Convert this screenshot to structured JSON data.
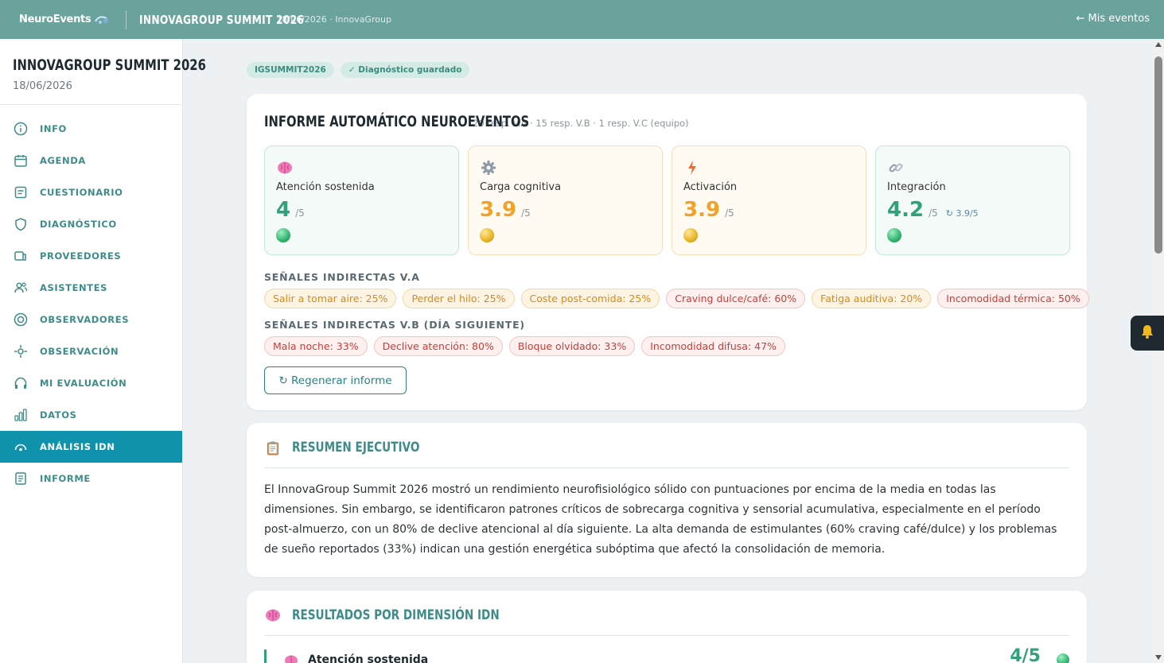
{
  "topbar": {
    "brand": "NeuroEvents",
    "event_title": "INNOVAGROUP SUMMIT 2026",
    "event_meta": "18/06/2026 · InnovaGroup",
    "back_link": "← Mis eventos"
  },
  "sidebar": {
    "title": "INNOVAGROUP SUMMIT 2026",
    "date": "18/06/2026",
    "items": [
      {
        "label": "INFO",
        "icon": "info-icon"
      },
      {
        "label": "AGENDA",
        "icon": "calendar-icon"
      },
      {
        "label": "CUESTIONARIO",
        "icon": "questionnaire-icon"
      },
      {
        "label": "DIAGNÓSTICO",
        "icon": "shield-icon"
      },
      {
        "label": "PROVEEDORES",
        "icon": "providers-icon"
      },
      {
        "label": "ASISTENTES",
        "icon": "users-icon"
      },
      {
        "label": "OBSERVADORES",
        "icon": "target-icon"
      },
      {
        "label": "OBSERVACIÓN",
        "icon": "crosshair-icon"
      },
      {
        "label": "MI EVALUACIÓN",
        "icon": "headphones-icon"
      },
      {
        "label": "DATOS",
        "icon": "bar-chart-icon"
      },
      {
        "label": "ANÁLISIS IDN",
        "icon": "gauge-icon",
        "active": true
      },
      {
        "label": "INFORME",
        "icon": "document-icon"
      }
    ]
  },
  "badges": {
    "code": "IGSUMMIT2026",
    "saved": "✓ Diagnóstico guardado"
  },
  "report": {
    "title": "INFORME AUTOMÁTICO NEUROEVENTOS",
    "meta": "20 resp. V.A · 15 resp. V.B · 1 resp. V.C (equipo)",
    "metrics": [
      {
        "label": "Atención sostenida",
        "value": "4",
        "unit": "/5",
        "extra": "",
        "status": "green",
        "icon": "brain-icon"
      },
      {
        "label": "Carga cognitiva",
        "value": "3.9",
        "unit": "/5",
        "extra": "",
        "status": "amber",
        "icon": "gear-icon"
      },
      {
        "label": "Activación",
        "value": "3.9",
        "unit": "/5",
        "extra": "",
        "status": "amber",
        "icon": "lightning-icon"
      },
      {
        "label": "Integración",
        "value": "4.2",
        "unit": "/5",
        "extra": "↻ 3.9/5",
        "status": "green",
        "icon": "link-icon"
      }
    ],
    "signals_va_label": "SEÑALES INDIRECTAS V.A",
    "signals_va": [
      {
        "text": "Salir a tomar aire: 25%",
        "tone": "amber"
      },
      {
        "text": "Perder el hilo: 25%",
        "tone": "amber"
      },
      {
        "text": "Coste post-comida: 25%",
        "tone": "amber"
      },
      {
        "text": "Craving dulce/café: 60%",
        "tone": "red"
      },
      {
        "text": "Fatiga auditiva: 20%",
        "tone": "amber"
      },
      {
        "text": "Incomodidad térmica: 50%",
        "tone": "red"
      }
    ],
    "signals_vb_label": "SEÑALES INDIRECTAS V.B (DÍA SIGUIENTE)",
    "signals_vb": [
      {
        "text": "Mala noche: 33%",
        "tone": "red"
      },
      {
        "text": "Declive atención: 80%",
        "tone": "red"
      },
      {
        "text": "Bloque olvidado: 33%",
        "tone": "red"
      },
      {
        "text": "Incomodidad difusa: 47%",
        "tone": "red"
      }
    ],
    "regen_button": "↻ Regenerar informe"
  },
  "summary": {
    "title": "RESUMEN EJECUTIVO",
    "icon": "clipboard-icon",
    "text": "El InnovaGroup Summit 2026 mostró un rendimiento neurofisiológico sólido con puntuaciones por encima de la media en todas las dimensiones. Sin embargo, se identificaron patrones críticos de sobrecarga cognitiva y sensorial acumulativa, especialmente en el período post-almuerzo, con un 80% de declive atencional al día siguiente. La alta demanda de estimulantes (60% craving café/dulce) y los problemas de sueño reportados (33%) indican una gestión energética subóptima que afectó la consolidación de memoria."
  },
  "dimensions": {
    "title": "RESULTADOS POR DIMENSIÓN IDN",
    "icon": "brain-icon",
    "rows": [
      {
        "name": "Atención sostenida",
        "score": "4/5",
        "status": "green"
      }
    ]
  },
  "colors": {
    "topbar": "#6aa39c",
    "accent": "#0f93ad",
    "teal_text": "#3d8c8a",
    "green": "#2fa27a",
    "amber": "#f0a32a",
    "red": "#cc3d37"
  }
}
